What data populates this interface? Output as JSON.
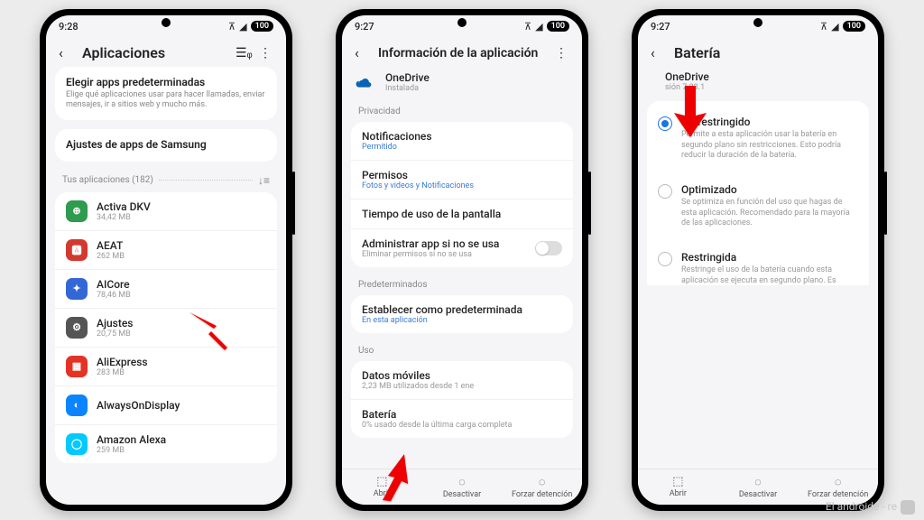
{
  "watermark": "El androide - re",
  "phone1": {
    "time": "9:28",
    "battery": "100",
    "title": "Aplicaciones",
    "card1": {
      "title": "Elegir apps predeterminadas",
      "desc": "Elige qué aplicaciones usar para hacer llamadas, enviar mensajes, ir a sitios web y mucho más."
    },
    "card2": {
      "title": "Ajustes de apps de Samsung"
    },
    "section": "Tus aplicaciones (182)",
    "apps": [
      {
        "name": "Activa DKV",
        "sub": "34,42 MB",
        "color": "#2e9b4e",
        "letter": "⊕"
      },
      {
        "name": "AEAT",
        "sub": "262 MB",
        "color": "#d33a2f",
        "letter": "🅰"
      },
      {
        "name": "AICore",
        "sub": "78,46 MB",
        "color": "#3367d6",
        "letter": "✦"
      },
      {
        "name": "Ajustes",
        "sub": "20,75 MB",
        "color": "#555",
        "letter": "⚙"
      },
      {
        "name": "AliExpress",
        "sub": "283 MB",
        "color": "#e43225",
        "letter": "▦"
      },
      {
        "name": "AlwaysOnDisplay",
        "sub": "",
        "color": "#0b84ff",
        "letter": "◐"
      },
      {
        "name": "Amazon Alexa",
        "sub": "259 MB",
        "color": "#00caff",
        "letter": "◯"
      }
    ]
  },
  "phone2": {
    "time": "9:27",
    "battery": "100",
    "title": "Información de la aplicación",
    "app": {
      "name": "OneDrive",
      "sub": "Instalada"
    },
    "sec1": "Privacidad",
    "rows1": [
      {
        "lbl": "Notificaciones",
        "val": "Permitido",
        "link": true
      },
      {
        "lbl": "Permisos",
        "val": "Fotos y videos y Notificaciones",
        "link": true
      },
      {
        "lbl": "Tiempo de uso de la pantalla",
        "val": ""
      },
      {
        "lbl": "Administrar app si no se usa",
        "val": "Eliminar permisos si no se usa",
        "toggle": true
      }
    ],
    "sec2": "Predeterminados",
    "rows2": [
      {
        "lbl": "Establecer como predeterminada",
        "val": "En esta aplicación",
        "link": true
      }
    ],
    "sec3": "Uso",
    "rows3": [
      {
        "lbl": "Datos móviles",
        "val": "2,23 MB utilizados desde 1 ene"
      },
      {
        "lbl": "Batería",
        "val": "0% usado desde la última carga completa"
      }
    ],
    "bottom": {
      "open": "Abrir",
      "disable": "Desactivar",
      "force": "Forzar detención"
    }
  },
  "phone3": {
    "time": "9:27",
    "battery": "100",
    "title": "Batería",
    "app": {
      "name": "OneDrive",
      "sub": "sión 7.23.1"
    },
    "options": [
      {
        "h": "No restringido",
        "d": "Permite a esta aplicación usar la batería en segundo plano sin restricciones. Esto podría reducir la duración de la batería.",
        "sel": true
      },
      {
        "h": "Optimizado",
        "d": "Se optimiza en función del uso que hagas de esta aplicación. Recomendado para la mayoría de las aplicaciones.",
        "sel": false
      },
      {
        "h": "Restringida",
        "d": "Restringe el uso de la batería cuando esta aplicación se ejecuta en segundo plano. Es posible que la aplicación no funcione según lo previsto y que las notificaciones se reciban con retraso.",
        "sel": false
      }
    ],
    "bottom": {
      "open": "Abrir",
      "disable": "Desactivar",
      "force": "Forzar detención"
    }
  }
}
